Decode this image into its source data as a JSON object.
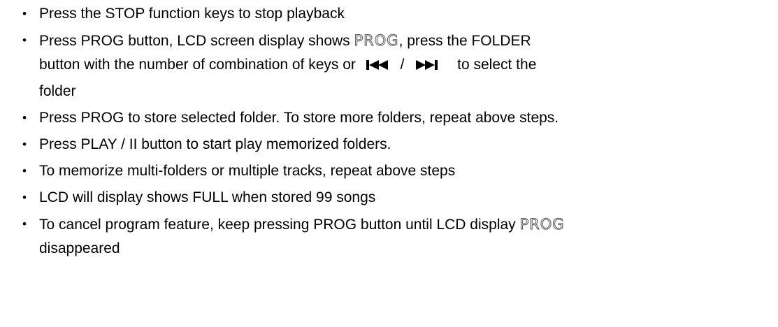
{
  "bullet": "•",
  "items": [
    {
      "text": "Press the STOP function keys to stop playback"
    },
    {
      "part1": "Press PROG button, LCD screen display shows ",
      "lcd": "PROG",
      "part2": ", press the FOLDER",
      "part3": "button with the number of combination of keys or",
      "slash": "/",
      "part4": "to select the",
      "part5": "folder",
      "icons": [
        "previous-track-icon",
        "next-track-icon"
      ]
    },
    {
      "text": "Press PROG to store selected folder. To store more folders, repeat above steps."
    },
    {
      "text": "Press PLAY / II button to start play memorized folders."
    },
    {
      "text": "To memorize multi-folders or multiple tracks, repeat above steps"
    },
    {
      "text": "LCD will display shows FULL when stored 99 songs"
    },
    {
      "part1": "To cancel program feature, keep pressing PROG button until LCD display ",
      "lcd": "PROG",
      "part2": "disappeared"
    }
  ]
}
